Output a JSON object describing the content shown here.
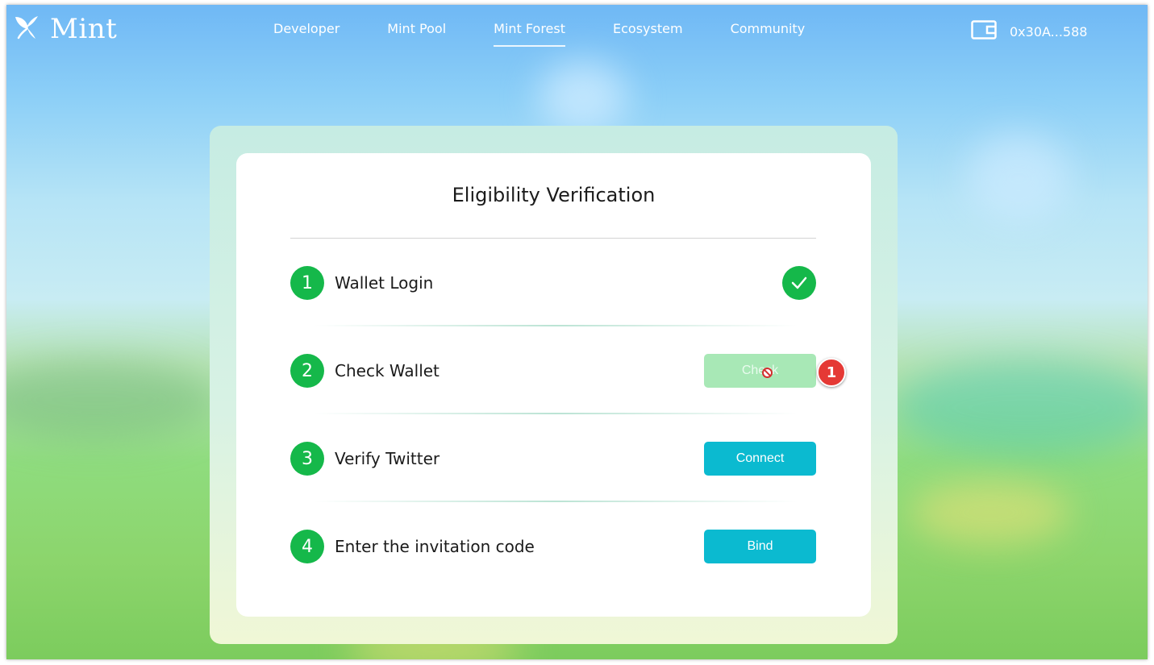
{
  "brand": {
    "name": "Mint",
    "icon": "mint-leaf-icon"
  },
  "nav": {
    "items": [
      {
        "label": "Developer",
        "active": false
      },
      {
        "label": "Mint Pool",
        "active": false
      },
      {
        "label": "Mint Forest",
        "active": true
      },
      {
        "label": "Ecosystem",
        "active": false
      },
      {
        "label": "Community",
        "active": false
      }
    ]
  },
  "wallet": {
    "icon": "wallet-icon",
    "address": "0x30A...588"
  },
  "dialog": {
    "title": "Eligibility Verification",
    "steps": [
      {
        "number": "1",
        "label": "Wallet Login",
        "status": "completed",
        "icon": "check-icon"
      },
      {
        "number": "2",
        "label": "Check Wallet",
        "button": "Check",
        "button_state": "disabled"
      },
      {
        "number": "3",
        "label": "Verify Twitter",
        "button": "Connect"
      },
      {
        "number": "4",
        "label": "Enter the invitation code",
        "button": "Bind"
      }
    ]
  },
  "overlay": {
    "marker_label": "1",
    "cursor": "not-allowed-icon"
  },
  "colors": {
    "accent_green": "#15b84a",
    "button_cyan": "#0bbad0",
    "button_disabled": "#a8e8b6"
  }
}
